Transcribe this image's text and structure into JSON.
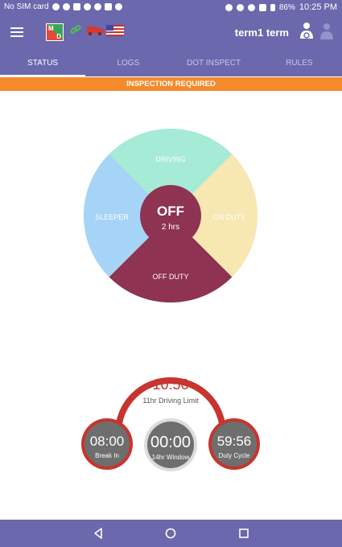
{
  "statusbar": {
    "carrier": "No SIM card",
    "battery": "86%",
    "time": "10:25 PM"
  },
  "header": {
    "logo_left": "M",
    "logo_right": "D",
    "user_name": "term1 term"
  },
  "tabs": [
    {
      "label": "STATUS",
      "active": true
    },
    {
      "label": "LOGS",
      "active": false
    },
    {
      "label": "DOT INSPECT",
      "active": false
    },
    {
      "label": "RULES",
      "active": false
    }
  ],
  "banner": {
    "text": "INSPECTION REQUIRED",
    "color": "#f48a2c"
  },
  "status_wheel": {
    "segments": {
      "driving": {
        "label": "DRIVING",
        "color": "#a5ebd6"
      },
      "on_duty": {
        "label": "ON DUTY",
        "color": "#f7e7b1"
      },
      "off_duty": {
        "label": "OFF DUTY",
        "color": "#8e3352"
      },
      "sleeper": {
        "label": "SLEEPER",
        "color": "#a6d4f7"
      }
    },
    "center_status": "OFF",
    "center_duration": "2 hrs"
  },
  "timers": {
    "driving_limit": {
      "value": "10:56",
      "label": "11hr Driving Limit"
    },
    "break": {
      "value": "08:00",
      "label": "Break In"
    },
    "window": {
      "value": "00:00",
      "label": "14hr Window"
    },
    "cycle": {
      "value": "59:56",
      "label": "Duty Cycle"
    }
  },
  "colors": {
    "primary": "#6b68ad",
    "accent_red": "#c8342f",
    "dial_gray": "#6e6e6e"
  }
}
